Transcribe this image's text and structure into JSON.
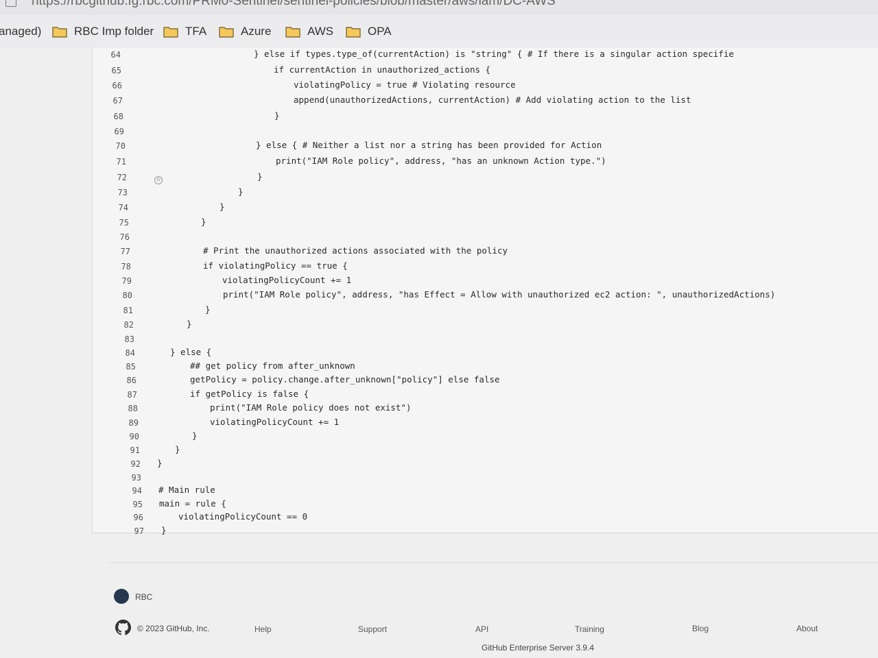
{
  "browser": {
    "url": "https://rbcgithub.fg.rbc.com/PRM0-Sentinel/sentinel-policies/blob/master/aws/iam/DC-AWS"
  },
  "bookmarks": [
    {
      "label": "anaged)",
      "icon": "none"
    },
    {
      "label": "RBC Imp folder",
      "icon": "folder-icon"
    },
    {
      "label": "TFA",
      "icon": "folder-icon"
    },
    {
      "label": "Azure",
      "icon": "folder-icon"
    },
    {
      "label": "AWS",
      "icon": "folder-icon"
    },
    {
      "label": "OPA",
      "icon": "folder-icon"
    }
  ],
  "code": {
    "lines": [
      {
        "n": "64",
        "text": "} else if types.type_of(currentAction) is \"string\" { # If there is a singular action specifie"
      },
      {
        "n": "65",
        "text": "if currentAction in unauthorized_actions {"
      },
      {
        "n": "66",
        "text": "violatingPolicy = true # Violating resource"
      },
      {
        "n": "67",
        "text": "append(unauthorizedActions, currentAction) # Add violating action to the list"
      },
      {
        "n": "68",
        "text": "}"
      },
      {
        "n": "69",
        "text": ""
      },
      {
        "n": "70",
        "text": "} else { # Neither a list nor a string has been provided for Action"
      },
      {
        "n": "71",
        "text": "print(\"IAM Role policy\", address, \"has an unknown Action type.\")"
      },
      {
        "n": "72",
        "text": "}"
      },
      {
        "n": "73",
        "text": "}"
      },
      {
        "n": "74",
        "text": "}"
      },
      {
        "n": "75",
        "text": "}"
      },
      {
        "n": "76",
        "text": ""
      },
      {
        "n": "77",
        "text": "# Print the unauthorized actions associated with the policy"
      },
      {
        "n": "78",
        "text": "if violatingPolicy == true {"
      },
      {
        "n": "79",
        "text": "violatingPolicyCount += 1"
      },
      {
        "n": "80",
        "text": "print(\"IAM Role policy\", address, \"has Effect = Allow with unauthorized ec2 action: \", unauthorizedActions)"
      },
      {
        "n": "81",
        "text": "}"
      },
      {
        "n": "82",
        "text": "}"
      },
      {
        "n": "83",
        "text": ""
      },
      {
        "n": "84",
        "text": "} else {"
      },
      {
        "n": "85",
        "text": "## get policy from after_unknown"
      },
      {
        "n": "86",
        "text": "getPolicy = policy.change.after_unknown[\"policy\"] else false"
      },
      {
        "n": "87",
        "text": "if getPolicy is false {"
      },
      {
        "n": "88",
        "text": "print(\"IAM Role policy does not exist\")"
      },
      {
        "n": "89",
        "text": "violatingPolicyCount += 1"
      },
      {
        "n": "90",
        "text": "}"
      },
      {
        "n": "91",
        "text": "}"
      },
      {
        "n": "92",
        "text": "}"
      },
      {
        "n": "93",
        "text": ""
      },
      {
        "n": "94",
        "text": "# Main rule"
      },
      {
        "n": "95",
        "text": "main = rule {"
      },
      {
        "n": "96",
        "text": "violatingPolicyCount == 0"
      },
      {
        "n": "97",
        "text": "}"
      }
    ]
  },
  "footer": {
    "org_name": "RBC",
    "copyright": "© 2023 GitHub, Inc.",
    "links": [
      "Help",
      "Support",
      "API",
      "Training",
      "Blog",
      "About"
    ],
    "server_version": "GitHub Enterprise Server 3.9.4"
  }
}
